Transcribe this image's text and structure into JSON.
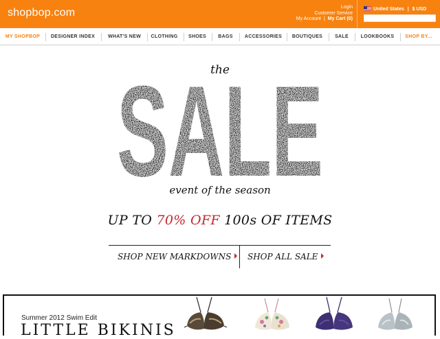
{
  "header": {
    "logo": "shopbop.com",
    "login": "Login",
    "customer_service": "Customer Service",
    "my_account": "My Account",
    "separator": "|",
    "my_cart": "My Cart",
    "cart_count": "(0)",
    "country": "United States",
    "currency": "$ USD",
    "locale_separator": "|",
    "brand_color": "#f7820f"
  },
  "nav": {
    "items": [
      {
        "label": "MY SHOPBOP"
      },
      {
        "label": "DESIGNER INDEX"
      },
      {
        "label": "WHAT'S NEW"
      },
      {
        "label": "CLOTHING"
      },
      {
        "label": "SHOES"
      },
      {
        "label": "BAGS"
      },
      {
        "label": "ACCESSORIES"
      },
      {
        "label": "BOUTIQUES"
      },
      {
        "label": "SALE"
      },
      {
        "label": "LOOKBOOKS"
      },
      {
        "label": "SHOP BY..."
      }
    ]
  },
  "hero": {
    "the": "the",
    "headline": "SALE",
    "subtitle": "event of the season",
    "promo_prefix": "UP TO ",
    "promo_highlight": "70% OFF",
    "promo_suffix": " 100s OF ITEMS",
    "accent_color": "#c3282e",
    "cta_markdowns": "SHOP NEW MARKDOWNS",
    "cta_all": "SHOP ALL SALE"
  },
  "banner": {
    "subtitle": "Summer 2012 Swim Edit",
    "title": "LITTLE BIKINIS",
    "products": [
      "bikini-top-snakeskin",
      "bikini-top-floral",
      "bikini-top-purple",
      "bikini-top-silver"
    ]
  }
}
